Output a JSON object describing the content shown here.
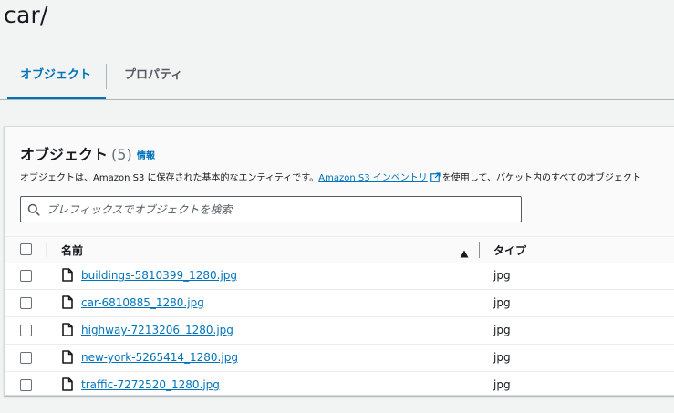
{
  "page": {
    "title": "car/"
  },
  "tabs": [
    {
      "label": "オブジェクト",
      "active": true
    },
    {
      "label": "プロパティ",
      "active": false
    }
  ],
  "panel": {
    "title": "オブジェクト",
    "count": "(5)",
    "info_label": "情報",
    "description_prefix": "オブジェクトは、Amazon S3 に保存された基本的なエンティティです。",
    "inventory_link": "Amazon S3 インベントリ",
    "description_suffix": "を使用して、バケット内のすべてのオブジェクト"
  },
  "search": {
    "placeholder": "プレフィックスでオブジェクトを検索",
    "value": ""
  },
  "table": {
    "columns": {
      "name": "名前",
      "type": "タイプ"
    },
    "sort": "ascending",
    "rows": [
      {
        "name": "buildings-5810399_1280.jpg",
        "type": "jpg"
      },
      {
        "name": "car-6810885_1280.jpg",
        "type": "jpg"
      },
      {
        "name": "highway-7213206_1280.jpg",
        "type": "jpg"
      },
      {
        "name": "new-york-5265414_1280.jpg",
        "type": "jpg"
      },
      {
        "name": "traffic-7272520_1280.jpg",
        "type": "jpg"
      }
    ]
  },
  "colors": {
    "accent": "#0073bb",
    "text": "#16191f",
    "background": "#f2f3f3"
  },
  "icons": {
    "search": "search-icon",
    "file": "file-icon",
    "external": "external-link-icon",
    "sort": "sort-ascending-icon"
  }
}
